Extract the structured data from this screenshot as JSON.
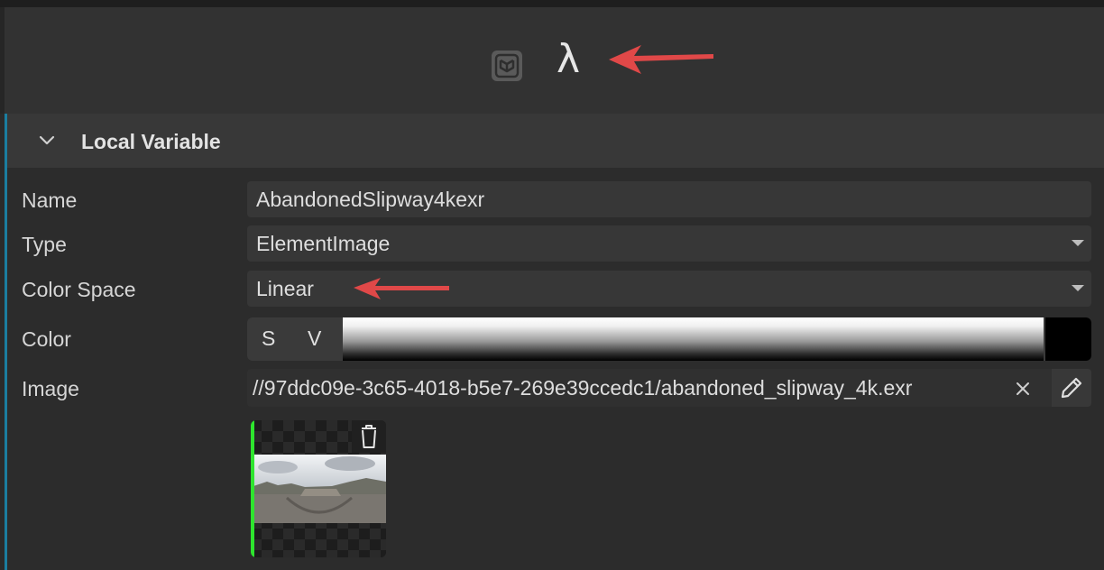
{
  "toolbar": {
    "icons": [
      "node-graph-icon",
      "lambda-icon"
    ],
    "lambda_glyph": "λ"
  },
  "section": {
    "title": "Local Variable",
    "expanded": true
  },
  "fields": {
    "name": {
      "label": "Name",
      "value": "AbandonedSlipway4kexr"
    },
    "type": {
      "label": "Type",
      "value": "ElementImage"
    },
    "color_space": {
      "label": "Color Space",
      "value": "Linear"
    },
    "color": {
      "label": "Color",
      "s_label": "S",
      "v_label": "V",
      "swatch_color": "#000000"
    },
    "image": {
      "label": "Image",
      "path": "//97ddc09e-3c65-4018-b5e7-269e39ccedc1/abandoned_slipway_4k.exr"
    }
  },
  "colors": {
    "accent": "#1b7ea0",
    "annotation_arrow": "#e04848",
    "thumbnail_marker": "#2ee52e"
  }
}
